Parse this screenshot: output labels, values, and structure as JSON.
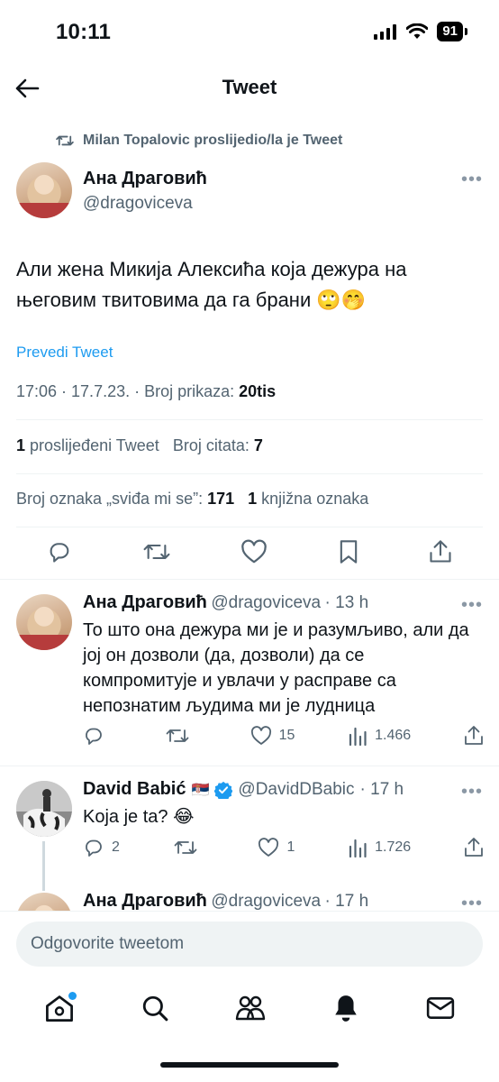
{
  "status_bar": {
    "time": "10:11",
    "battery": "91"
  },
  "header": {
    "title": "Tweet"
  },
  "retweet_context": {
    "text": "Milan Topalovic proslijedio/la je Tweet"
  },
  "main_tweet": {
    "author_name": "Ана Драговић",
    "author_handle": "@dragoviceva",
    "text": "Али жена Микија Алексића која дежура на његовим твитовима да га брани 🙄🤭",
    "translate_label": "Prevedi Tweet",
    "timestamp": "17:06 · 17.7.23. · ",
    "views_label": "Broj prikaza: ",
    "views_value": "20tis",
    "retweets_count": "1",
    "retweets_label": "proslijeđeni Tweet",
    "quotes_label": "Broj citata: ",
    "quotes_count": "7",
    "likes_label": "Broj oznaka „sviđa mi se”: ",
    "likes_count": "171",
    "bookmarks_count": "1",
    "bookmarks_label": "knjižna oznaka"
  },
  "replies": [
    {
      "author_name": "Ана Драговић",
      "author_handle": "@dragoviceva",
      "time": "· 13 h",
      "text": "То што она дежура ми је и разумљиво, али да јој он дозволи (да, дозволи) да се компромитује  и увлачи у расправе са непознатим људима ми је лудница",
      "reply_count": "",
      "retweet_count": "",
      "like_count": "15",
      "view_count": "1.466"
    },
    {
      "author_name": "David Babić",
      "flag": "🇷🇸",
      "author_handle": "@DavidDBabic",
      "time": "· 17 h",
      "text": "Koja je ta? 😂",
      "reply_count": "2",
      "retweet_count": "",
      "like_count": "1",
      "view_count": "1.726"
    },
    {
      "author_name": "Ана Драговић",
      "author_handle": "@dragoviceva",
      "time": "· 17 h"
    }
  ],
  "reply_input": {
    "placeholder": "Odgovorite tweetom"
  },
  "colors": {
    "accent": "#1d9bf0",
    "secondary_text": "#536471",
    "divider": "#eff3f4"
  },
  "tab_bar": {
    "items": [
      "home-icon",
      "search-icon",
      "communities-icon",
      "notifications-icon",
      "messages-icon"
    ]
  }
}
